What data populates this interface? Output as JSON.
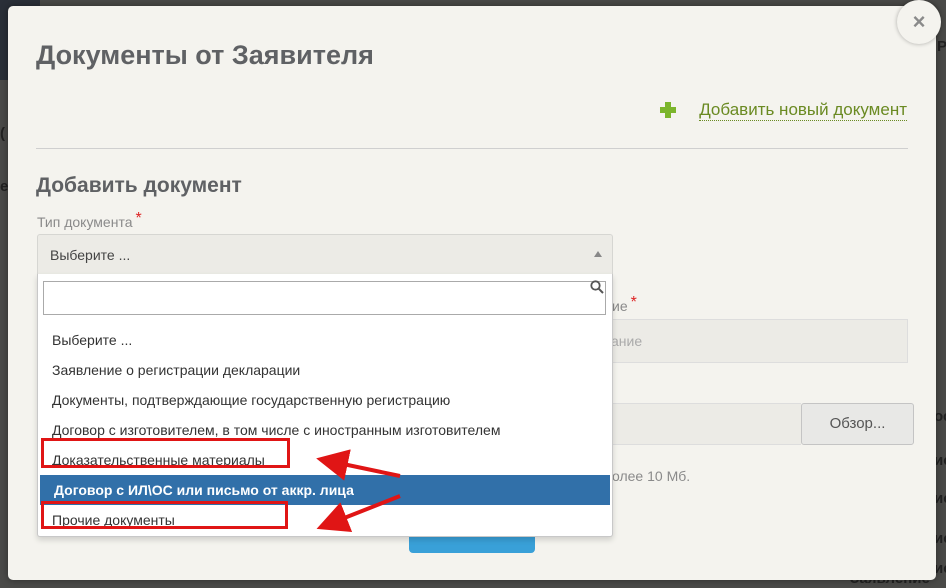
{
  "background": {
    "snippets": [
      "P",
      "(",
      "ет",
      "ос",
      "ис",
      "ис",
      "ис",
      "ис",
      "Заявление"
    ]
  },
  "modal": {
    "title": "Документы от Заявителя",
    "close_symbol": "×",
    "add_new_link": "Добавить новый документ",
    "section_title": "Добавить документ",
    "doc_type_label": "Тип документа",
    "required_mark": "*",
    "select_value": "Выберите ...",
    "search_placeholder": "",
    "options": [
      "Выберите ...",
      "Заявление о регистрации декларации",
      "Документы, подтверждающие государственную регистрацию",
      "Договор с изготовителем, в том числе с иностранным изготовителем",
      "Доказательственные материалы",
      "Договор с ИЛ\\ОС или письмо от аккр. лица",
      "Прочие документы"
    ],
    "selected_index": 5,
    "hidden_label_fragment": "ие",
    "hidden_placeholder_fragment": "ание",
    "browse_label": "Обзор...",
    "size_hint_fragment": "олее 10 Мб."
  },
  "colors": {
    "selected": "#3170a9",
    "highlight": "#e01515",
    "add": "#7bb52c",
    "save": "#39a0d8"
  }
}
